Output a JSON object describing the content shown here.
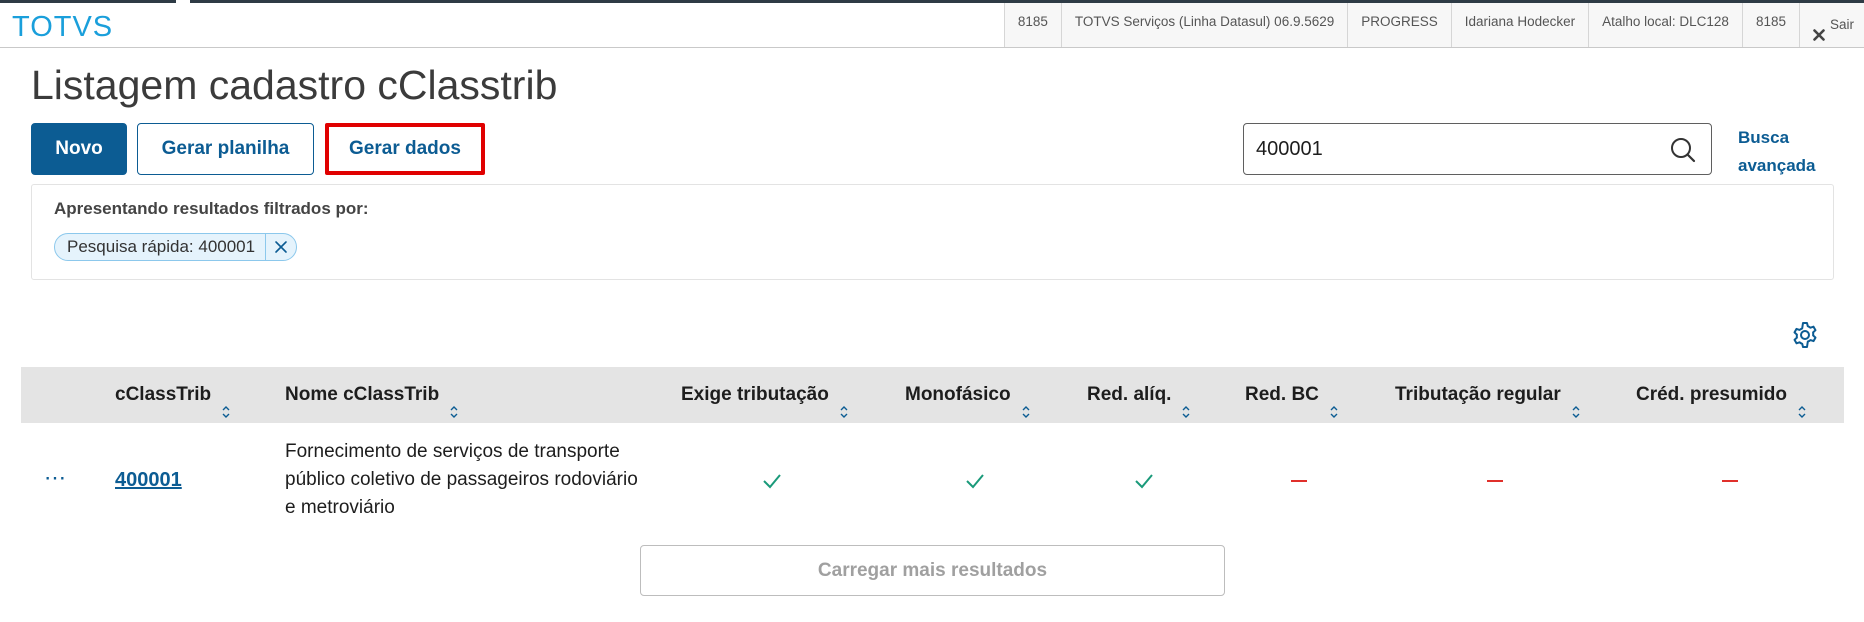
{
  "topbar": {
    "logo": "TOTVS",
    "info": [
      "8185",
      "TOTVS Serviços (Linha Datasul) 06.9.5629",
      "PROGRESS",
      "Idariana Hodecker",
      "Atalho local: DLC128",
      "8185"
    ],
    "exit_label": "Sair"
  },
  "page": {
    "title": "Listagem cadastro cClasstrib"
  },
  "actions": {
    "new_label": "Novo",
    "spreadsheet_label": "Gerar planilha",
    "generate_label": "Gerar dados"
  },
  "search": {
    "value": "400001",
    "advanced_line1": "Busca",
    "advanced_line2": "avançada"
  },
  "filter": {
    "label": "Apresentando resultados filtrados por:",
    "chip": "Pesquisa rápida: 400001"
  },
  "table": {
    "columns": [
      "cClassTrib",
      "Nome cClassTrib",
      "Exige tributação",
      "Monofásico",
      "Red. alíq.",
      "Red. BC",
      "Tributação regular",
      "Créd. presumido"
    ],
    "rows": [
      {
        "actions": "⋯",
        "code": "400001",
        "name": "Fornecimento de serviços de transporte público coletivo de passageiros rodoviário e metroviário",
        "flags": [
          "check",
          "check",
          "check",
          "dash",
          "dash",
          "dash"
        ]
      }
    ]
  },
  "load_more_label": "Carregar mais resultados",
  "colors": {
    "primary": "#0c5c93",
    "check": "#1a9a7a",
    "dash": "#e0302b",
    "highlight": "#e00000"
  }
}
